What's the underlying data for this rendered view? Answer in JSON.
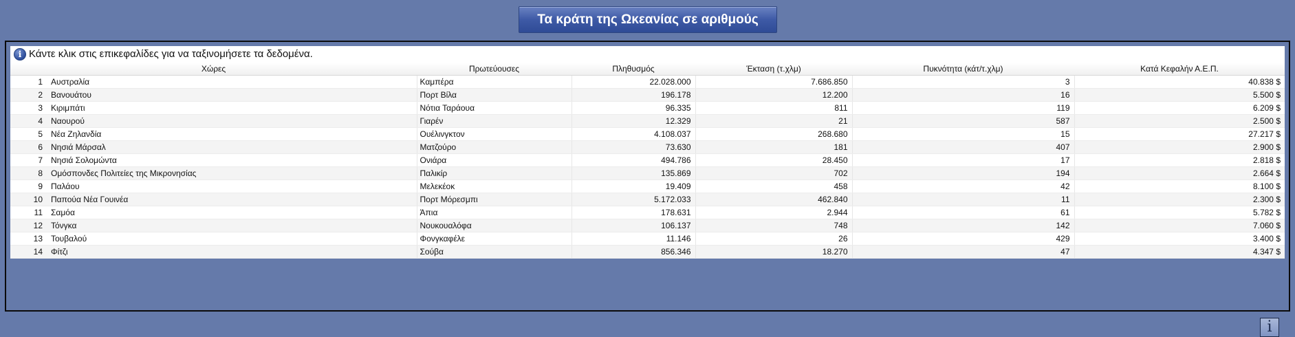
{
  "title": "Τα κράτη της Ωκεανίας σε αριθμούς",
  "hint": "Κάντε κλικ στις επικεφαλίδες για να ταξινομήσετε τα δεδομένα.",
  "icons": {
    "hint": "info-icon",
    "corner": "info-icon"
  },
  "columns": [
    "Χώρες",
    "Πρωτεύουσες",
    "Πληθυσμός",
    "Έκταση (τ.χλμ)",
    "Πυκνότητα (κάτ/τ.χλμ)",
    "Κατά Κεφαλήν Α.Ε.Π."
  ],
  "rows": [
    {
      "idx": "1",
      "country": "Αυστραλία",
      "capital": "Καμπέρα",
      "population": "22.028.000",
      "area": "7.686.850",
      "density": "3",
      "gdp": "40.838 $"
    },
    {
      "idx": "2",
      "country": "Βανουάτου",
      "capital": "Πορτ Βίλα",
      "population": "196.178",
      "area": "12.200",
      "density": "16",
      "gdp": "5.500 $"
    },
    {
      "idx": "3",
      "country": "Κιριμπάτι",
      "capital": "Νότια Ταράουα",
      "population": "96.335",
      "area": "811",
      "density": "119",
      "gdp": "6.209 $"
    },
    {
      "idx": "4",
      "country": "Ναουρού",
      "capital": "Γιαρέν",
      "population": "12.329",
      "area": "21",
      "density": "587",
      "gdp": "2.500 $"
    },
    {
      "idx": "5",
      "country": "Νέα Ζηλανδία",
      "capital": "Ουέλινγκτον",
      "population": "4.108.037",
      "area": "268.680",
      "density": "15",
      "gdp": "27.217 $"
    },
    {
      "idx": "6",
      "country": "Νησιά Μάρσαλ",
      "capital": "Ματζούρο",
      "population": "73.630",
      "area": "181",
      "density": "407",
      "gdp": "2.900 $"
    },
    {
      "idx": "7",
      "country": "Νησιά Σολομώντα",
      "capital": "Ονιάρα",
      "population": "494.786",
      "area": "28.450",
      "density": "17",
      "gdp": "2.818 $"
    },
    {
      "idx": "8",
      "country": "Ομόσπονδες Πολιτείες της Μικρονησίας",
      "capital": "Παλικίρ",
      "population": "135.869",
      "area": "702",
      "density": "194",
      "gdp": "2.664 $"
    },
    {
      "idx": "9",
      "country": "Παλάου",
      "capital": "Μελεκέοκ",
      "population": "19.409",
      "area": "458",
      "density": "42",
      "gdp": "8.100 $"
    },
    {
      "idx": "10",
      "country": "Παπούα Νέα Γουινέα",
      "capital": "Πορτ Μόρεσμπι",
      "population": "5.172.033",
      "area": "462.840",
      "density": "11",
      "gdp": "2.300 $"
    },
    {
      "idx": "11",
      "country": "Σαμόα",
      "capital": "Άπια",
      "population": "178.631",
      "area": "2.944",
      "density": "61",
      "gdp": "5.782 $"
    },
    {
      "idx": "12",
      "country": "Τόνγκα",
      "capital": "Νουκουαλόφα",
      "population": "106.137",
      "area": "748",
      "density": "142",
      "gdp": "7.060 $"
    },
    {
      "idx": "13",
      "country": "Τουβαλού",
      "capital": "Φονγκαφέλε",
      "population": "11.146",
      "area": "26",
      "density": "429",
      "gdp": "3.400 $"
    },
    {
      "idx": "14",
      "country": "Φίτζι",
      "capital": "Σούβα",
      "population": "856.346",
      "area": "18.270",
      "density": "47",
      "gdp": "4.347 $"
    }
  ]
}
